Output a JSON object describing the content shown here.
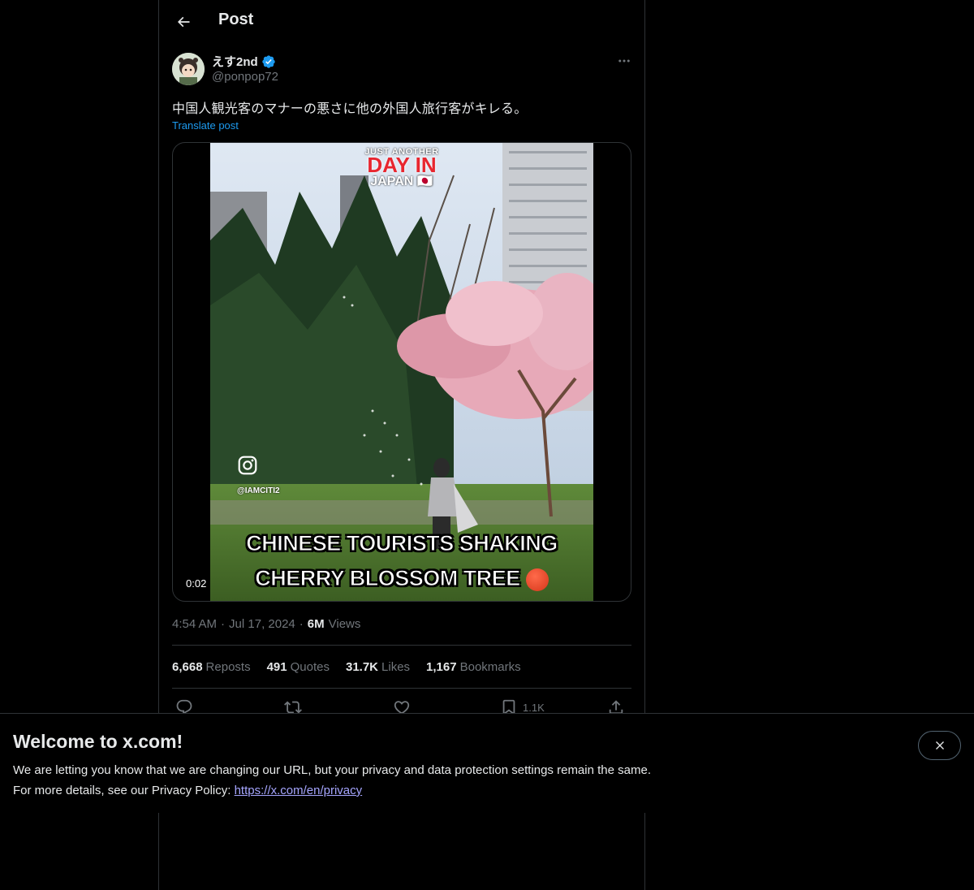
{
  "header": {
    "title": "Post",
    "back_icon": "arrow-left-icon"
  },
  "author": {
    "display_name": "えす2nd",
    "handle": "@ponpop72",
    "verified": true,
    "verified_color": "#1d9bf0"
  },
  "post": {
    "text": "中国人観光客のマナーの悪さに他の外国人旅行客がキレる。",
    "translate_label": "Translate post",
    "timestamp": "4:54 AM",
    "date": "Jul 17, 2024",
    "views_count": "6M",
    "views_label": "Views"
  },
  "media": {
    "overlay_top_small": "JUST ANOTHER",
    "overlay_top_big": "DAY IN",
    "overlay_top_small2": "JAPAN 🇯🇵",
    "ig_handle": "@IAMCITI2",
    "caption_line1": "CHINESE TOURISTS SHAKING",
    "caption_line2": "CHERRY BLOSSOM TREE",
    "timecode": "0:02"
  },
  "stats": {
    "reposts_count": "6,668",
    "reposts_label": "Reposts",
    "quotes_count": "491",
    "quotes_label": "Quotes",
    "likes_count": "31.7K",
    "likes_label": "Likes",
    "bookmarks_count": "1,167",
    "bookmarks_label": "Bookmarks"
  },
  "actions": {
    "bookmark_count": "1.1K"
  },
  "banner": {
    "title": "Welcome to x.com!",
    "line1": "We are letting you know that we are changing our URL, but your privacy and data protection settings remain the same.",
    "line2_prefix": "For more details, see our Privacy Policy: ",
    "link": "https://x.com/en/privacy"
  },
  "colors": {
    "background": "#000000",
    "text_primary": "#e7e9ea",
    "text_secondary": "#71767b",
    "accent": "#1d9bf0",
    "border": "#2f3336"
  }
}
